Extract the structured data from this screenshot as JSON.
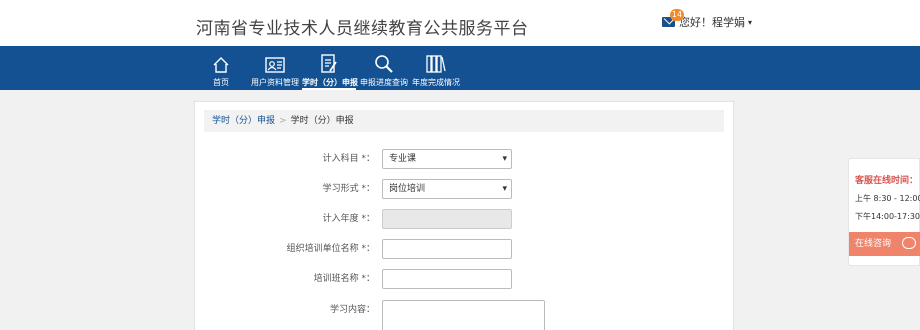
{
  "header": {
    "site_title": "河南省专业技术人员继续教育公共服务平台",
    "mail_count": "14",
    "greeting": "您好！程学娟",
    "dropdown_caret": "▾"
  },
  "nav": {
    "items": [
      {
        "label": "首页",
        "icon": "home-icon"
      },
      {
        "label": "用户资料管理",
        "icon": "profile-card-icon"
      },
      {
        "label": "学时（分）申报",
        "icon": "document-edit-icon",
        "active": true
      },
      {
        "label": "申报进度查询",
        "icon": "search-icon"
      },
      {
        "label": "年度完成情况",
        "icon": "books-icon"
      }
    ]
  },
  "breadcrumb": {
    "link": "学时（分）申报",
    "separator": ">",
    "current": "学时（分）申报"
  },
  "form": {
    "subject_label": "计入科目 *：",
    "subject_value": "专业课",
    "study_form_label": "学习形式 *：",
    "study_form_value": "岗位培训",
    "year_label": "计入年度 *：",
    "org_label": "组织培训单位名称 *：",
    "class_label": "培训班名称 *：",
    "content_label": "学习内容："
  },
  "service": {
    "title": "客服在线时间：",
    "morning": "上午 8:30 - 12:00",
    "afternoon": "下午14:00-17:30",
    "consult": "在线咨询"
  },
  "colors": {
    "nav_bg": "#135193",
    "badge": "#f28c28",
    "consult_bg": "#f0846b",
    "service_title": "#d9534f"
  }
}
